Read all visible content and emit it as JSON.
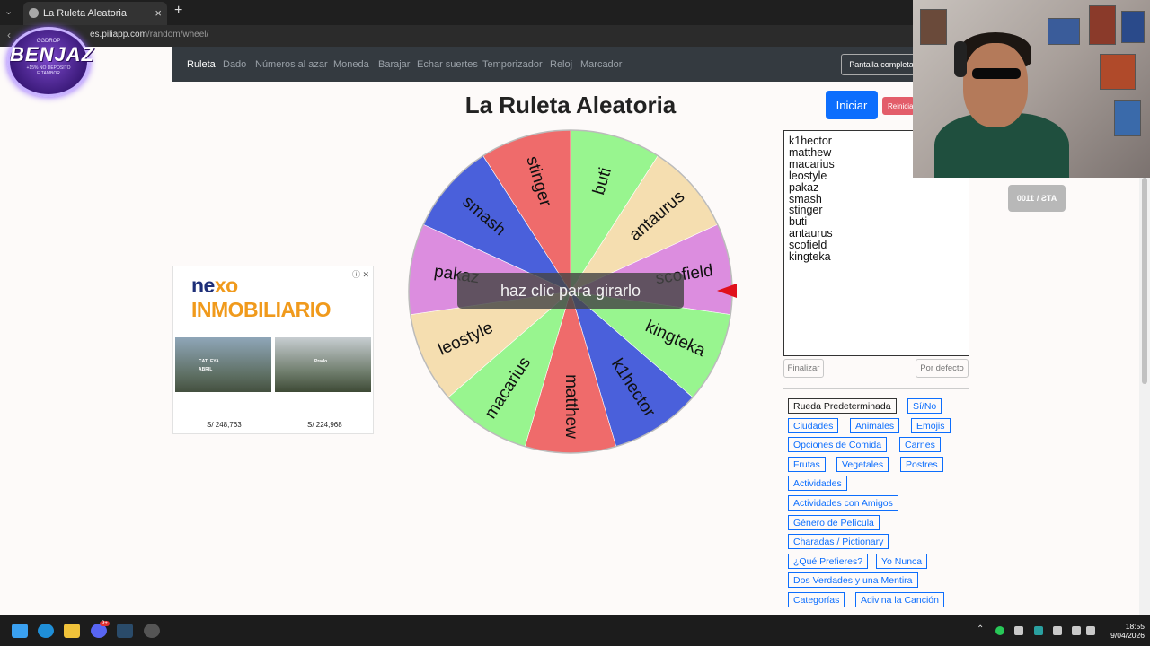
{
  "browser": {
    "tab_title": "La Ruleta Aleatoria",
    "url_host": "es.piliapp.com",
    "url_path": "/random/wheel/"
  },
  "overlay_logo": {
    "top": "GGDROP",
    "main": "BENJAZ",
    "small1": "+15% NO DEPÓSITO",
    "small2": "E TAMBOR"
  },
  "nav": {
    "items": [
      "Ruleta",
      "Dado",
      "Números al azar",
      "Moneda",
      "Barajar",
      "Echar suertes",
      "Temporizador",
      "Reloj",
      "Marcador"
    ],
    "fullscreen": "Pantalla completa"
  },
  "page": {
    "title": "La Ruleta Aleatoria",
    "start_button": "Iniciar",
    "reset_button": "Reinicia"
  },
  "wheel": {
    "center_label": "haz clic para girarlo",
    "segments": [
      {
        "label": "buti",
        "color": "#98f58f"
      },
      {
        "label": "antaurus",
        "color": "#f5deb0"
      },
      {
        "label": "scofield",
        "color": "#dc8ddf"
      },
      {
        "label": "kingteka",
        "color": "#98f58f"
      },
      {
        "label": "k1hector",
        "color": "#4a60db"
      },
      {
        "label": "matthew",
        "color": "#ef6b6b"
      },
      {
        "label": "macarius",
        "color": "#98f58f"
      },
      {
        "label": "leostyle",
        "color": "#f5deb0"
      },
      {
        "label": "pakaz",
        "color": "#dc8ddf"
      },
      {
        "label": "smash",
        "color": "#4a60db"
      },
      {
        "label": "stinger",
        "color": "#ef6b6b"
      }
    ],
    "pointer_color": "#e0101c"
  },
  "ad": {
    "brand_a": "ne",
    "brand_b": "xo",
    "brand_c": " INMOBILIARIO",
    "img1_label": "CATLEYA",
    "img1_label2": "ABRIL",
    "img2_label": "Prado",
    "price1": "S/ 248,763",
    "price2": "S/ 224,968"
  },
  "entries": [
    "k1hector",
    "matthew",
    "macarius",
    "leostyle",
    "pakaz",
    "smash",
    "stinger",
    "buti",
    "antaurus",
    "scofield",
    "kingteka"
  ],
  "controls": {
    "finish": "Finalizar",
    "default": "Por defecto"
  },
  "presets": [
    "Rueda Predeterminada",
    "Sí/No",
    "Ciudades",
    "Animales",
    "Emojis",
    "Opciones de Comida",
    "Carnes",
    "Frutas",
    "Vegetales",
    "Postres",
    "Actividades",
    "Actividades con Amigos",
    "Género de Película",
    "Charadas / Pictionary",
    "¿Qué Prefieres?",
    "Yo Nunca",
    "Dos Verdades y una Mentira",
    "Categorías",
    "Adivina la Canción"
  ],
  "sticker": "ATS \\ 1100",
  "taskbar": {
    "time": "18:55",
    "date": "9/04/2026",
    "discord_badge": "9+"
  }
}
